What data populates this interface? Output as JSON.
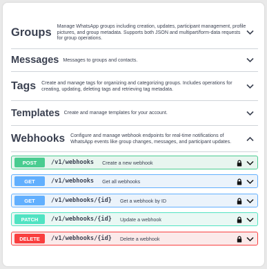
{
  "sections": [
    {
      "title": "Groups",
      "description": "Manage WhatsApp groups including creation, updates, participant management, profile pictures, and group metadata. Supports both JSON and multipart/form-data requests for group operations.",
      "expanded": false
    },
    {
      "title": "Messages",
      "description": "Messages to groups and contacts.",
      "expanded": false
    },
    {
      "title": "Tags",
      "description": "Create and manage tags for organizing and categorizing groups. Includes operations for creating, updating, deleting tags and retrieving tag metadata.",
      "expanded": false
    },
    {
      "title": "Templates",
      "description": "Create and manage templates for your account.",
      "expanded": false
    },
    {
      "title": "Webhooks",
      "description": "Configure and manage webhook endpoints for real-time notifications of WhatsApp events like group changes, messages, and participant updates.",
      "expanded": true
    }
  ],
  "operations": [
    {
      "method": "POST",
      "path": "/v1/webhooks",
      "summary": "Create a new webhook",
      "color": "#49cc90"
    },
    {
      "method": "GET",
      "path": "/v1/webhooks",
      "summary": "Get all webhooks",
      "color": "#61affe"
    },
    {
      "method": "GET",
      "path": "/v1/webhooks/{id}",
      "summary": "Get a webhook by ID",
      "color": "#61affe"
    },
    {
      "method": "PATCH",
      "path": "/v1/webhooks/{id}",
      "summary": "Update a webhook",
      "color": "#50e3c2"
    },
    {
      "method": "DELETE",
      "path": "/v1/webhooks/{id}",
      "summary": "Delete a webhook",
      "color": "#f93e3e"
    }
  ],
  "icons": {
    "section_toggle": "chevron-down-icon",
    "section_toggle_expanded": "chevron-up-icon",
    "auth": "lock-icon",
    "operation_toggle": "chevron-down-icon"
  }
}
